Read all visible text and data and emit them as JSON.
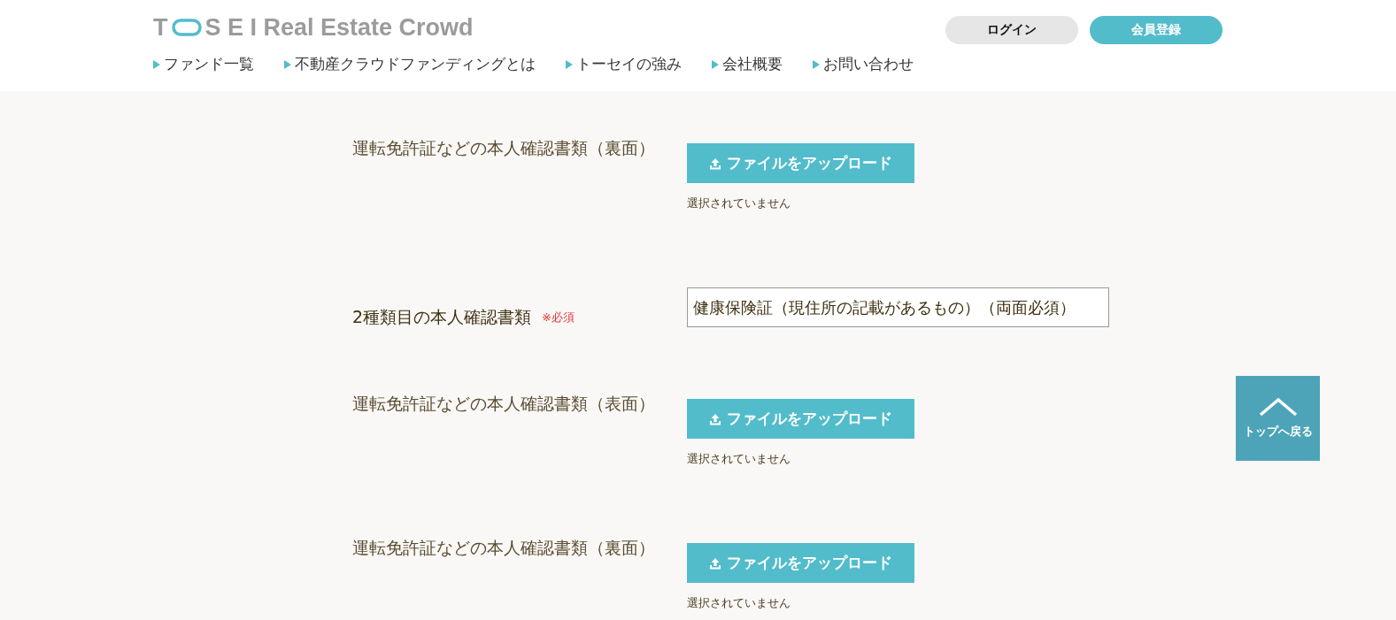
{
  "header": {
    "logo": {
      "left": "T",
      "right": "S E I Real Estate Crowd"
    },
    "nav": [
      "ファンド一覧",
      "不動産クラウドファンディングとは",
      "トーセイの強み",
      "会社概要",
      "お問い合わせ"
    ],
    "login": "ログイン",
    "register": "会員登録"
  },
  "form": {
    "rows": [
      {
        "kind": "upload",
        "label": "運転免許証などの本人確認書類（裏面）",
        "button": "ファイルをアップロード",
        "status": "選択されていません"
      },
      {
        "kind": "select",
        "label": "2種類目の本人確認書類",
        "required": "※必須",
        "value": "健康保険証（現住所の記載があるもの）（両面必須）"
      },
      {
        "kind": "upload",
        "label": "運転免許証などの本人確認書類（表面）",
        "button": "ファイルをアップロード",
        "status": "選択されていません"
      },
      {
        "kind": "upload",
        "label": "運転免許証などの本人確認書類（裏面）",
        "button": "ファイルをアップロード",
        "status": "選択されていません"
      }
    ]
  },
  "back_to_top": "トップへ戻る"
}
